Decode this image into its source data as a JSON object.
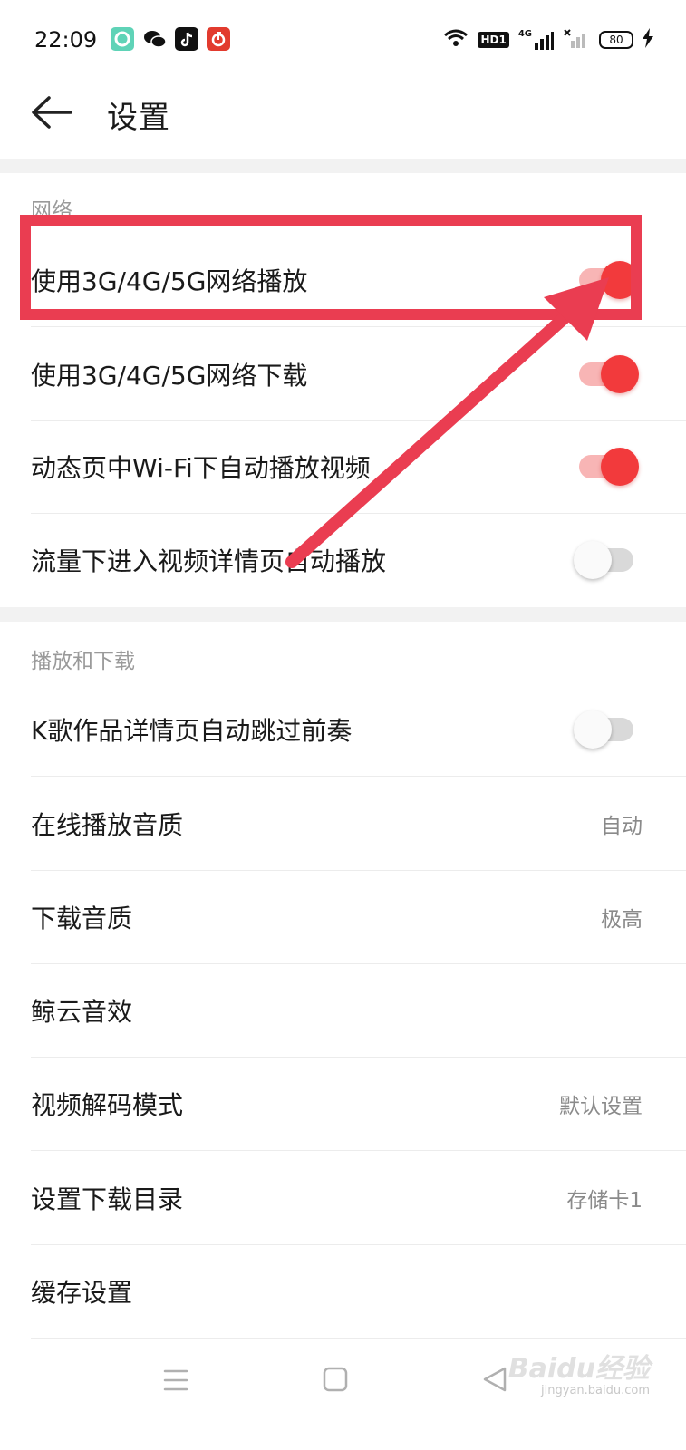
{
  "status_bar": {
    "time": "22:09",
    "hd_label": "HD1",
    "network_label": "4G",
    "battery": "80",
    "app_icons": [
      "music-app-icon",
      "wechat-icon",
      "tiktok-icon",
      "netease-music-icon"
    ]
  },
  "header": {
    "title": "设置",
    "back_icon": "arrow-left-icon"
  },
  "sections": {
    "network": {
      "title": "网络",
      "items": [
        {
          "label": "使用3G/4G/5G网络播放",
          "toggle": true
        },
        {
          "label": "使用3G/4G/5G网络下载",
          "toggle": true
        },
        {
          "label": "动态页中Wi-Fi下自动播放视频",
          "toggle": true
        },
        {
          "label": "流量下进入视频详情页自动播放",
          "toggle": false
        }
      ]
    },
    "playback": {
      "title": "播放和下载",
      "items": [
        {
          "label": "K歌作品详情页自动跳过前奏",
          "toggle": false
        },
        {
          "label": "在线播放音质",
          "value": "自动"
        },
        {
          "label": "下载音质",
          "value": "极高"
        },
        {
          "label": "鲸云音效",
          "value": ""
        },
        {
          "label": "视频解码模式",
          "value": "默认设置"
        },
        {
          "label": "设置下载目录",
          "value": "存储卡1"
        },
        {
          "label": "缓存设置",
          "value": ""
        }
      ]
    }
  },
  "nav_bar": {
    "icons": [
      "menu-icon",
      "home-square-icon",
      "back-triangle-icon"
    ]
  },
  "watermark": {
    "logo": "Baidu经验",
    "url": "jingyan.baidu.com"
  },
  "colors": {
    "accent": "#f23a3c",
    "accent_track": "#f8b5b5",
    "annotation": "#ea3d51",
    "section_gap": "#f2f2f2"
  }
}
